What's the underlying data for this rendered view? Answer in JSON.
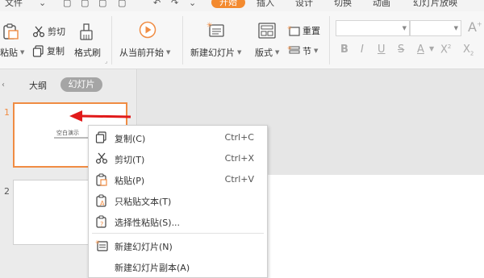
{
  "menubar": {
    "file_label": "文件",
    "tabs": [
      "开始",
      "插入",
      "设计",
      "切换",
      "动画",
      "幻灯片放映"
    ],
    "active_tab": "开始"
  },
  "ribbon": {
    "paste": "粘贴",
    "cut": "剪切",
    "copy": "复制",
    "format_painter": "格式刷",
    "play_from_current": "从当前开始",
    "new_slide": "新建幻灯片",
    "layout": "版式",
    "reset": "重置",
    "section": "节"
  },
  "panel": {
    "outline_tab": "大纲",
    "slides_tab": "幻灯片",
    "slides": [
      {
        "number": "1",
        "title": "空白演示"
      },
      {
        "number": "2"
      }
    ]
  },
  "context_menu": {
    "items": [
      {
        "label": "复制(C)",
        "shortcut": "Ctrl+C",
        "icon": "copy-icon"
      },
      {
        "label": "剪切(T)",
        "shortcut": "Ctrl+X",
        "icon": "scissors-icon"
      },
      {
        "label": "粘贴(P)",
        "shortcut": "Ctrl+V",
        "icon": "paste-icon"
      },
      {
        "label": "只粘贴文本(T)",
        "shortcut": "",
        "icon": "paste-text-icon"
      },
      {
        "label": "选择性粘贴(S)...",
        "shortcut": "",
        "icon": "paste-special-icon"
      },
      {
        "label": "新建幻灯片(N)",
        "shortcut": "",
        "icon": "new-slide-icon"
      },
      {
        "label": "新建幻灯片副本(A)",
        "shortcut": "",
        "icon": ""
      }
    ]
  },
  "colors": {
    "accent": "#f38a2f",
    "selection_border": "#f08c43",
    "annotation_arrow": "#e11a1a"
  }
}
